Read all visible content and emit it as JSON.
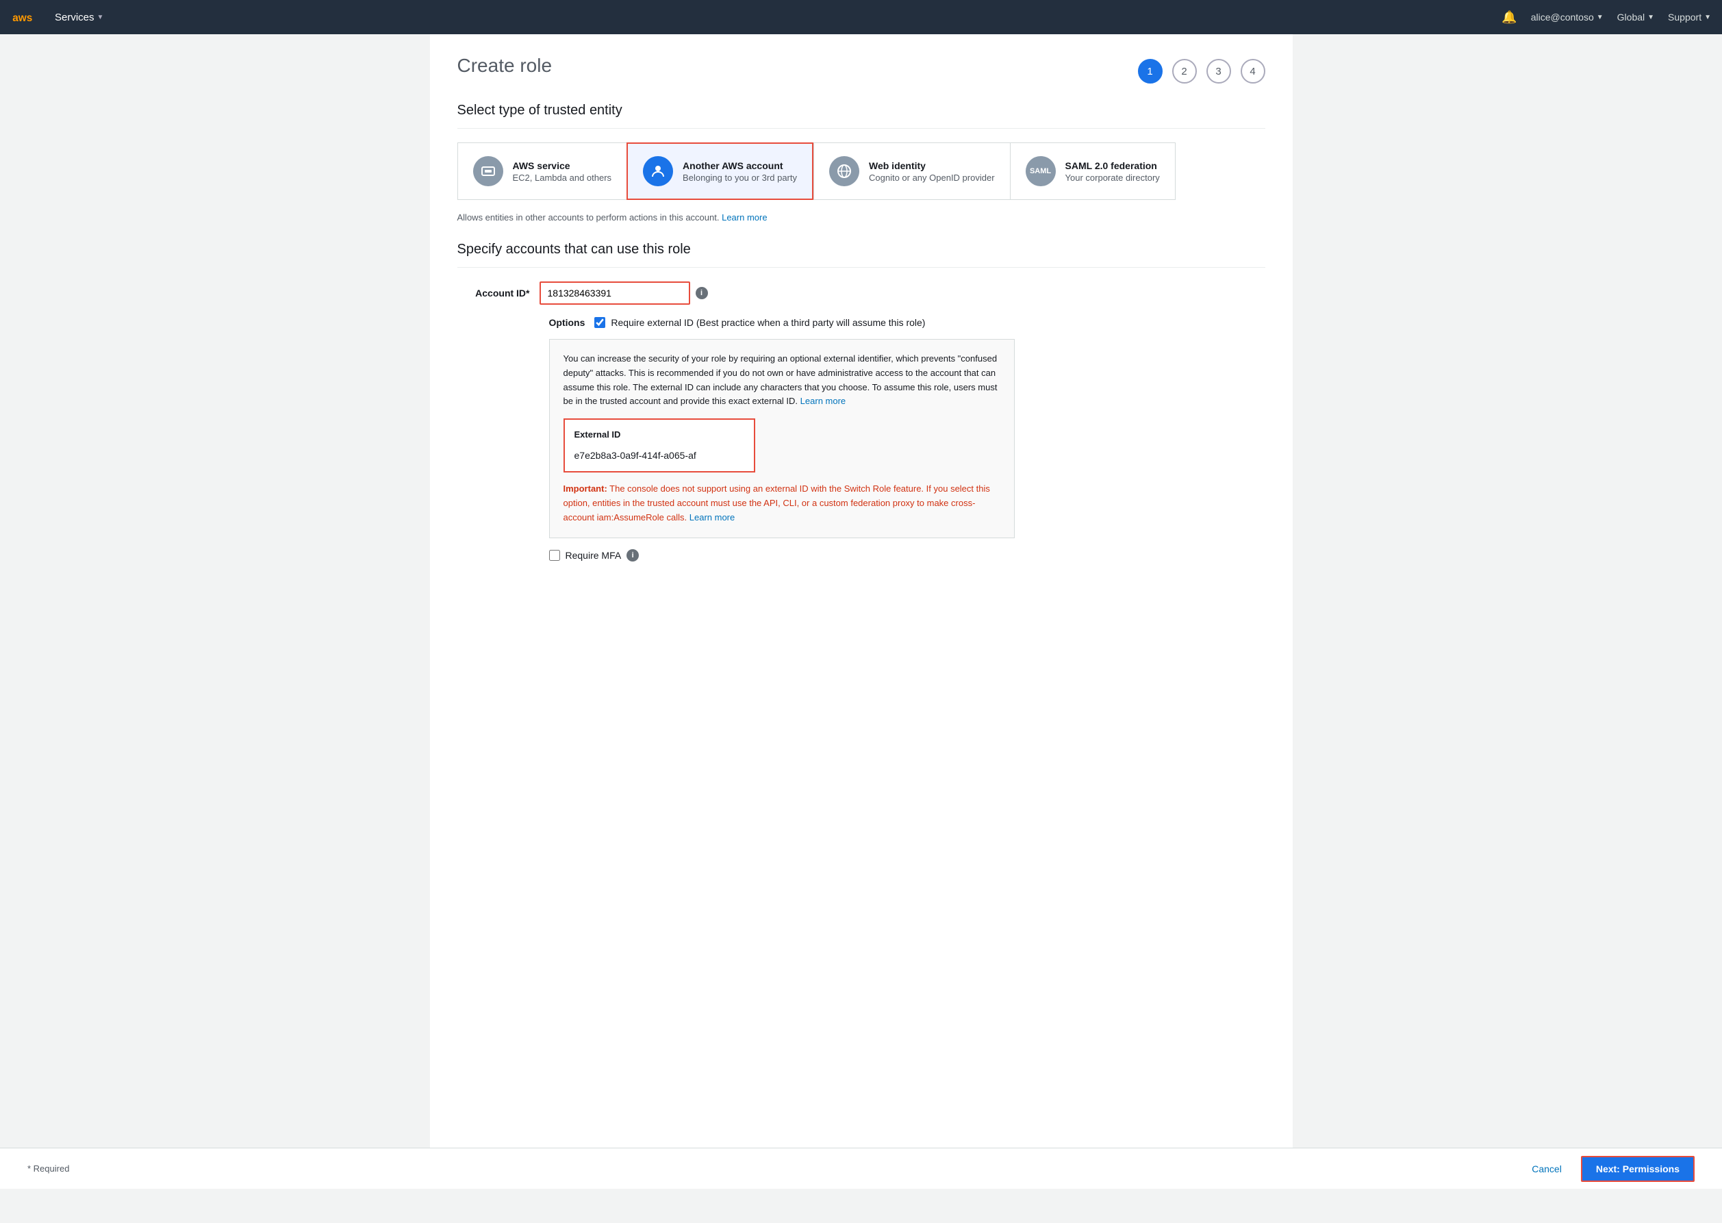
{
  "nav": {
    "services_label": "Services",
    "bell_label": "Notifications",
    "user_label": "alice@contoso",
    "region_label": "Global",
    "support_label": "Support"
  },
  "page": {
    "title": "Create role",
    "steps": [
      "1",
      "2",
      "3",
      "4"
    ],
    "active_step": 0
  },
  "section1": {
    "title": "Select type of trusted entity",
    "cards": [
      {
        "id": "aws-service",
        "title": "AWS service",
        "subtitle": "EC2, Lambda and others",
        "selected": false
      },
      {
        "id": "another-aws-account",
        "title": "Another AWS account",
        "subtitle": "Belonging to you or 3rd party",
        "selected": true
      },
      {
        "id": "web-identity",
        "title": "Web identity",
        "subtitle": "Cognito or any OpenID provider",
        "selected": false
      },
      {
        "id": "saml-federation",
        "title": "SAML 2.0 federation",
        "subtitle": "Your corporate directory",
        "selected": false
      }
    ],
    "description": "Allows entities in other accounts to perform actions in this account.",
    "learn_more_link": "Learn more"
  },
  "section2": {
    "title": "Specify accounts that can use this role",
    "account_id_label": "Account ID",
    "account_id_value": "181328463391",
    "account_id_placeholder": "",
    "options_label": "Options",
    "require_external_id_label": "Require external ID (Best practice when a third party will assume this role)",
    "require_external_id_checked": true,
    "info_box_text": "You can increase the security of your role by requiring an optional external identifier, which prevents \"confused deputy\" attacks. This is recommended if you do not own or have administrative access to the account that can assume this role. The external ID can include any characters that you choose. To assume this role, users must be in the trusted account and provide this exact external ID.",
    "info_learn_more": "Learn more",
    "external_id_label": "External ID",
    "external_id_value": "e7e2b8a3-0a9f-414f-a065-af",
    "important_label": "Important:",
    "important_text": "The console does not support using an external ID with the Switch Role feature. If you select this option, entities in the trusted account must use the API, CLI, or a custom federation proxy to make cross-account iam:AssumeRole calls.",
    "important_learn_more": "Learn more",
    "require_mfa_label": "Require MFA"
  },
  "footer": {
    "required_note": "* Required",
    "cancel_label": "Cancel",
    "next_label": "Next: Permissions"
  }
}
